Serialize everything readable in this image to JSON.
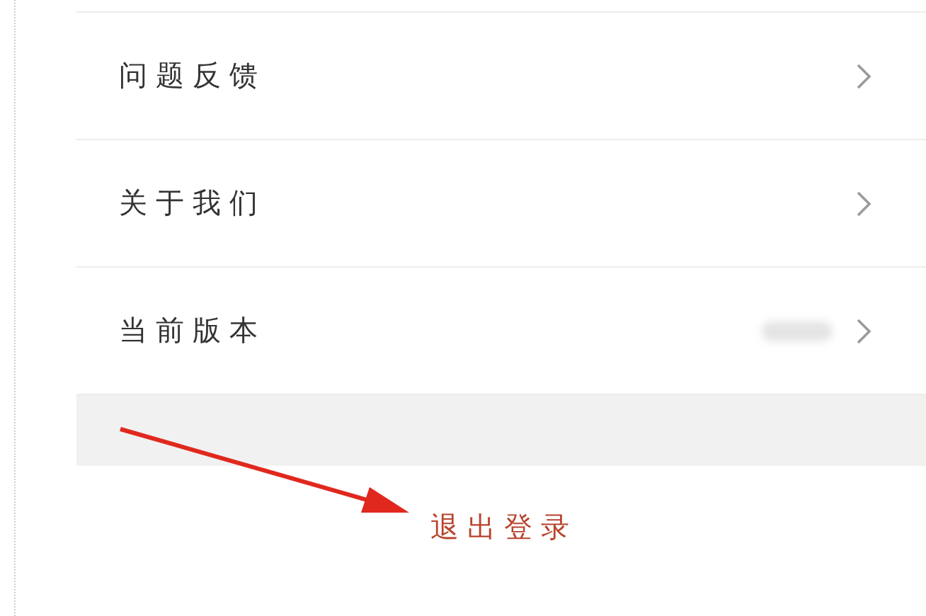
{
  "menu_items": [
    {
      "label": "问题反馈",
      "kind": "link"
    },
    {
      "label": "关于我们",
      "kind": "link"
    },
    {
      "label": "当前版本",
      "kind": "value"
    }
  ],
  "logout": {
    "label": "退出登录"
  }
}
